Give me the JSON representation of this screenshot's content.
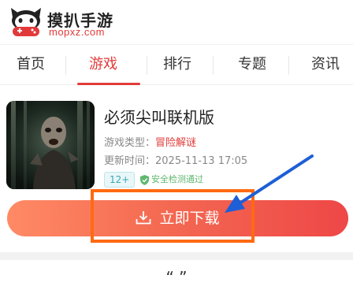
{
  "header": {
    "logo_cn": "摸扒手游",
    "logo_en": "mopxz.com"
  },
  "nav": {
    "items": [
      {
        "label": "首页",
        "active": false
      },
      {
        "label": "游戏",
        "active": true
      },
      {
        "label": "排行",
        "active": false
      },
      {
        "label": "专题",
        "active": false
      },
      {
        "label": "资讯",
        "active": false
      }
    ],
    "active_color": "#e23a3a"
  },
  "game": {
    "title": "必须尖叫联机版",
    "type_label": "游戏类型：",
    "type_value": "冒险解谜",
    "update_label": "更新时间：",
    "update_value": "2025-11-13 17:05",
    "age_badge": "12+",
    "safe_badge": "安全检测通过"
  },
  "download": {
    "label": "立即下载"
  },
  "footer": {
    "quote": "“ ”"
  },
  "colors": {
    "accent": "#e23a3a",
    "highlight": "#ff6a12",
    "arrow": "#1f5fd6"
  }
}
